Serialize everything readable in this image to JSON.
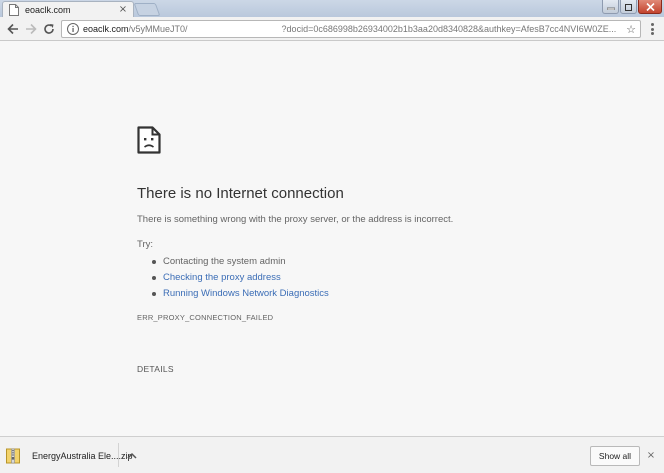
{
  "tab": {
    "title": "eoaclk.com",
    "close_glyph": "×"
  },
  "omnibox": {
    "host": "eoaclk.com",
    "path": "/v5yMMueJT0/",
    "query": "?docid=0c686998b26934002b1b3aa20d8340828&authkey=AfesB7cc4NVI6W0ZE...",
    "star_glyph": "☆"
  },
  "error": {
    "title": "There is no Internet connection",
    "description": "There is something wrong with the proxy server, or the address is incorrect.",
    "try_label": "Try:",
    "suggestions": [
      {
        "text": "Contacting the system admin",
        "link": false
      },
      {
        "text": "Checking the proxy address",
        "link": true
      },
      {
        "text": "Running Windows Network Diagnostics",
        "link": true
      }
    ],
    "code": "ERR_PROXY_CONNECTION_FAILED",
    "details_label": "DETAILS"
  },
  "download_shelf": {
    "file_name": "EnergyAustralia Ele....zip",
    "show_all_label": "Show all",
    "close_glyph": "×"
  },
  "icons": {
    "tab": "document-icon",
    "back": "back-arrow-icon",
    "forward": "forward-arrow-icon",
    "reload": "reload-icon",
    "site_info": "info-icon",
    "bookmark": "star-icon",
    "menu": "kebab-menu-icon",
    "error": "sad-page-icon",
    "download": "zip-file-icon"
  },
  "colors": {
    "link": "#3b6db6",
    "title_text": "#333333",
    "body_text": "#646464",
    "page_background": "#f7f7f7",
    "window_close": "#c3432d"
  }
}
